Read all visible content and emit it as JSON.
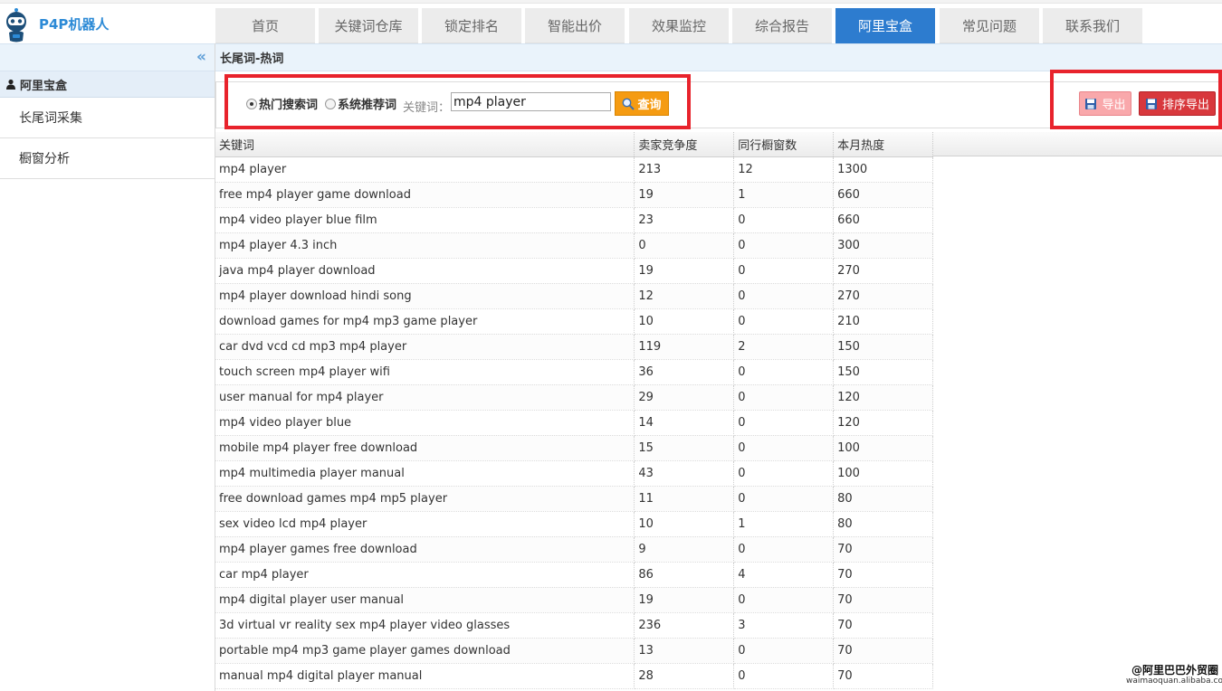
{
  "app": {
    "logo_text": "P4P机器人"
  },
  "nav": {
    "tabs": [
      {
        "label": "首页"
      },
      {
        "label": "关键词仓库"
      },
      {
        "label": "锁定排名"
      },
      {
        "label": "智能出价"
      },
      {
        "label": "效果监控"
      },
      {
        "label": "综合报告"
      },
      {
        "label": "阿里宝盒"
      },
      {
        "label": "常见问题"
      },
      {
        "label": "联系我们"
      }
    ],
    "active": "阿里宝盒"
  },
  "sidebar": {
    "collapse_glyph": "«",
    "group": "阿里宝盒",
    "items": [
      {
        "label": "长尾词采集"
      },
      {
        "label": "橱窗分析"
      }
    ]
  },
  "main": {
    "title": "长尾词-热词",
    "search": {
      "radio_hot": "热门搜索词",
      "radio_system": "系统推荐词",
      "selected": "热门搜索词",
      "keyword_label": "关键词：",
      "keyword_value": "mp4 player",
      "query_label": "查询"
    },
    "export_label": "导出",
    "sort_export_label": "排序导出"
  },
  "table": {
    "columns": [
      "关键词",
      "卖家竞争度",
      "同行橱窗数",
      "本月热度"
    ],
    "rows": [
      [
        "mp4 player",
        "213",
        "12",
        "1300"
      ],
      [
        "free mp4 player game download",
        "19",
        "1",
        "660"
      ],
      [
        "mp4 video player blue film",
        "23",
        "0",
        "660"
      ],
      [
        "mp4 player 4.3 inch",
        "0",
        "0",
        "300"
      ],
      [
        "java mp4 player download",
        "19",
        "0",
        "270"
      ],
      [
        "mp4 player download hindi song",
        "12",
        "0",
        "270"
      ],
      [
        "download games for mp4 mp3 game player",
        "10",
        "0",
        "210"
      ],
      [
        "car dvd vcd cd mp3 mp4 player",
        "119",
        "2",
        "150"
      ],
      [
        "touch screen mp4 player wifi",
        "36",
        "0",
        "150"
      ],
      [
        "user manual for mp4 player",
        "29",
        "0",
        "120"
      ],
      [
        "mp4 video player blue",
        "14",
        "0",
        "120"
      ],
      [
        "mobile mp4 player free download",
        "15",
        "0",
        "100"
      ],
      [
        "mp4 multimedia player manual",
        "43",
        "0",
        "100"
      ],
      [
        "free download games mp4 mp5 player",
        "11",
        "0",
        "80"
      ],
      [
        "sex video lcd mp4 player",
        "10",
        "1",
        "80"
      ],
      [
        "mp4 player games free download",
        "9",
        "0",
        "70"
      ],
      [
        "car mp4 player",
        "86",
        "4",
        "70"
      ],
      [
        "mp4 digital player user manual",
        "19",
        "0",
        "70"
      ],
      [
        "3d virtual vr reality sex mp4 player video glasses",
        "236",
        "3",
        "70"
      ],
      [
        "portable mp4 mp3 game player games download",
        "13",
        "0",
        "70"
      ],
      [
        "manual mp4 digital player manual",
        "28",
        "0",
        "70"
      ]
    ]
  },
  "watermark": {
    "line1": "@阿里巴巴外贸圈",
    "line2": "waimaoquan.alibaba.com"
  },
  "colors": {
    "accent": "#2d7ccf",
    "highlight_frame": "#e8232c",
    "query_button": "#f59b12",
    "export_button": "#f9a8ab",
    "sort_export_button": "#d8383d"
  }
}
